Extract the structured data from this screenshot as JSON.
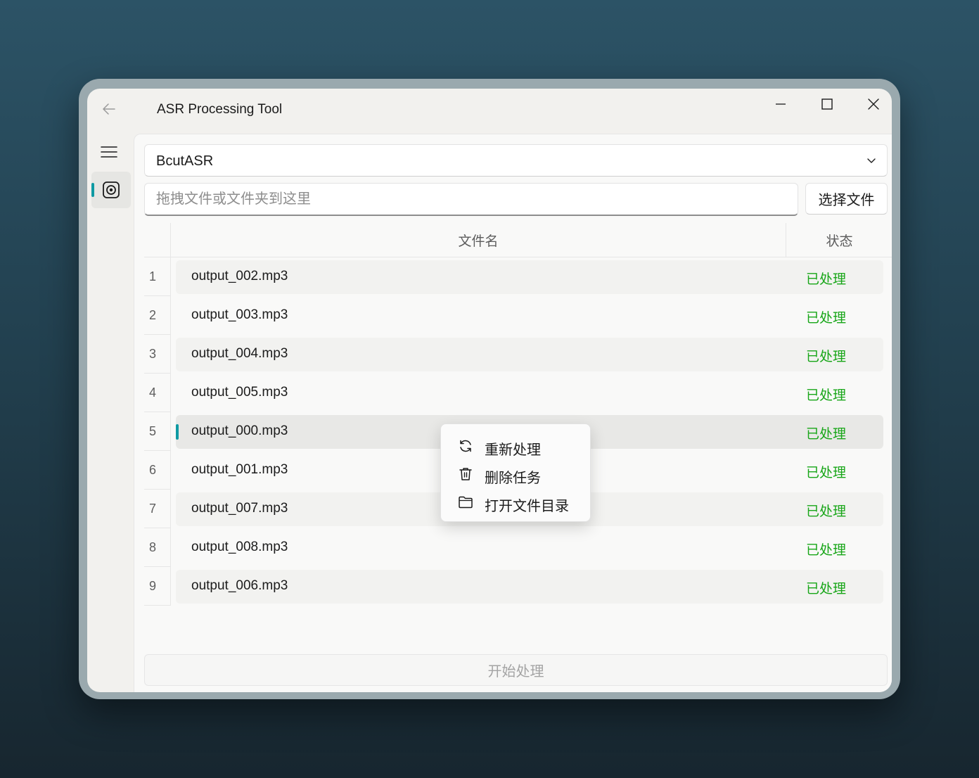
{
  "window": {
    "title": "ASR Processing Tool"
  },
  "icons": {
    "back": "arrow-left-icon",
    "minimize": "minimize-icon",
    "maximize": "maximize-icon",
    "close": "close-icon",
    "menu": "hamburger-menu-icon",
    "nav": "record-icon",
    "dropdown": "chevron-down-icon"
  },
  "asr_engine": {
    "selected": "BcutASR"
  },
  "file_input": {
    "placeholder": "拖拽文件或文件夹到这里",
    "value": ""
  },
  "select_file_button": "选择文件",
  "table": {
    "headers": {
      "name": "文件名",
      "status": "状态"
    },
    "rows": [
      {
        "index": "1",
        "name": "output_002.mp3",
        "status": "已处理"
      },
      {
        "index": "2",
        "name": "output_003.mp3",
        "status": "已处理"
      },
      {
        "index": "3",
        "name": "output_004.mp3",
        "status": "已处理"
      },
      {
        "index": "4",
        "name": "output_005.mp3",
        "status": "已处理"
      },
      {
        "index": "5",
        "name": "output_000.mp3",
        "status": "已处理"
      },
      {
        "index": "6",
        "name": "output_001.mp3",
        "status": "已处理"
      },
      {
        "index": "7",
        "name": "output_007.mp3",
        "status": "已处理"
      },
      {
        "index": "8",
        "name": "output_008.mp3",
        "status": "已处理"
      },
      {
        "index": "9",
        "name": "output_006.mp3",
        "status": "已处理"
      }
    ],
    "selected_row": "5"
  },
  "context_menu": {
    "items": [
      {
        "label": "重新处理",
        "icon": "refresh-icon"
      },
      {
        "label": "删除任务",
        "icon": "trash-icon"
      },
      {
        "label": "打开文件目录",
        "icon": "folder-icon"
      }
    ]
  },
  "start_button": "开始处理",
  "colors": {
    "accent": "#0f9aa3",
    "status_done": "#18a618",
    "background_top": "#2c5366",
    "background_bottom": "#17262f"
  }
}
